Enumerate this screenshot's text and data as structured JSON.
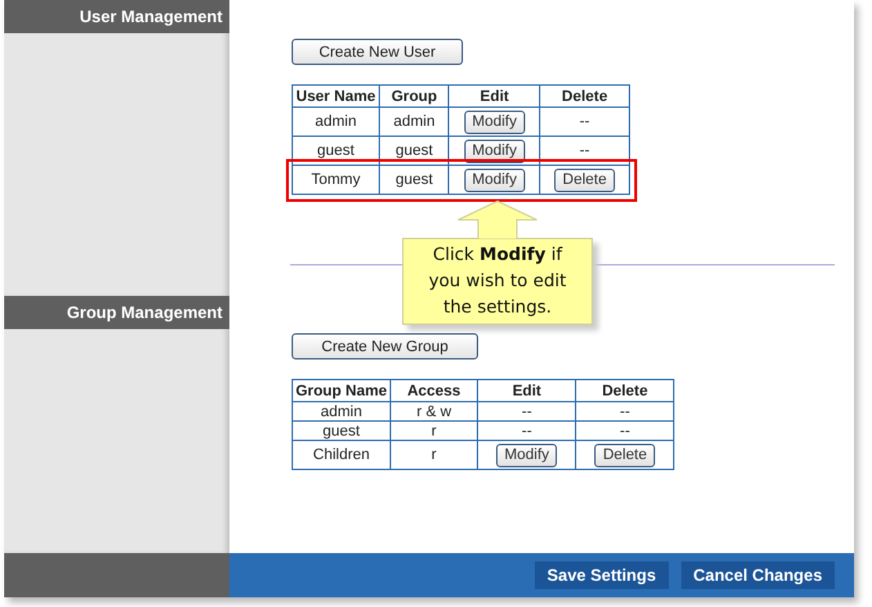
{
  "sidebar": {
    "sections": [
      {
        "label": "User Management"
      },
      {
        "label": "Group Management"
      }
    ]
  },
  "user_management": {
    "create_button": "Create New User",
    "columns": [
      "User Name",
      "Group",
      "Edit",
      "Delete"
    ],
    "rows": [
      {
        "highlighted": false,
        "cells": [
          {
            "kind": "text",
            "text": "admin"
          },
          {
            "kind": "text",
            "text": "admin"
          },
          {
            "kind": "button",
            "text": "Modify"
          },
          {
            "kind": "text",
            "text": "--"
          }
        ]
      },
      {
        "highlighted": false,
        "cells": [
          {
            "kind": "text",
            "text": "guest"
          },
          {
            "kind": "text",
            "text": "guest"
          },
          {
            "kind": "button",
            "text": "Modify"
          },
          {
            "kind": "text",
            "text": "--"
          }
        ]
      },
      {
        "highlighted": true,
        "cells": [
          {
            "kind": "text",
            "text": "Tommy"
          },
          {
            "kind": "text",
            "text": "guest"
          },
          {
            "kind": "button",
            "text": "Modify"
          },
          {
            "kind": "button",
            "text": "Delete"
          }
        ]
      }
    ]
  },
  "callout": {
    "text": "Click **Modify** if you wish to edit the settings."
  },
  "group_management": {
    "create_button": "Create New Group",
    "columns": [
      "Group Name",
      "Access",
      "Edit",
      "Delete"
    ],
    "rows": [
      {
        "highlighted": false,
        "cells": [
          {
            "kind": "text",
            "text": "admin"
          },
          {
            "kind": "text",
            "text": "r & w"
          },
          {
            "kind": "text",
            "text": "--"
          },
          {
            "kind": "text",
            "text": "--"
          }
        ]
      },
      {
        "highlighted": false,
        "cells": [
          {
            "kind": "text",
            "text": "guest"
          },
          {
            "kind": "text",
            "text": "r"
          },
          {
            "kind": "text",
            "text": "--"
          },
          {
            "kind": "text",
            "text": "--"
          }
        ]
      },
      {
        "highlighted": false,
        "cells": [
          {
            "kind": "text",
            "text": "Children"
          },
          {
            "kind": "text",
            "text": "r"
          },
          {
            "kind": "button",
            "text": "Modify"
          },
          {
            "kind": "button",
            "text": "Delete"
          }
        ]
      }
    ]
  },
  "footer": {
    "buttons": [
      "Save Settings",
      "Cancel Changes"
    ]
  }
}
